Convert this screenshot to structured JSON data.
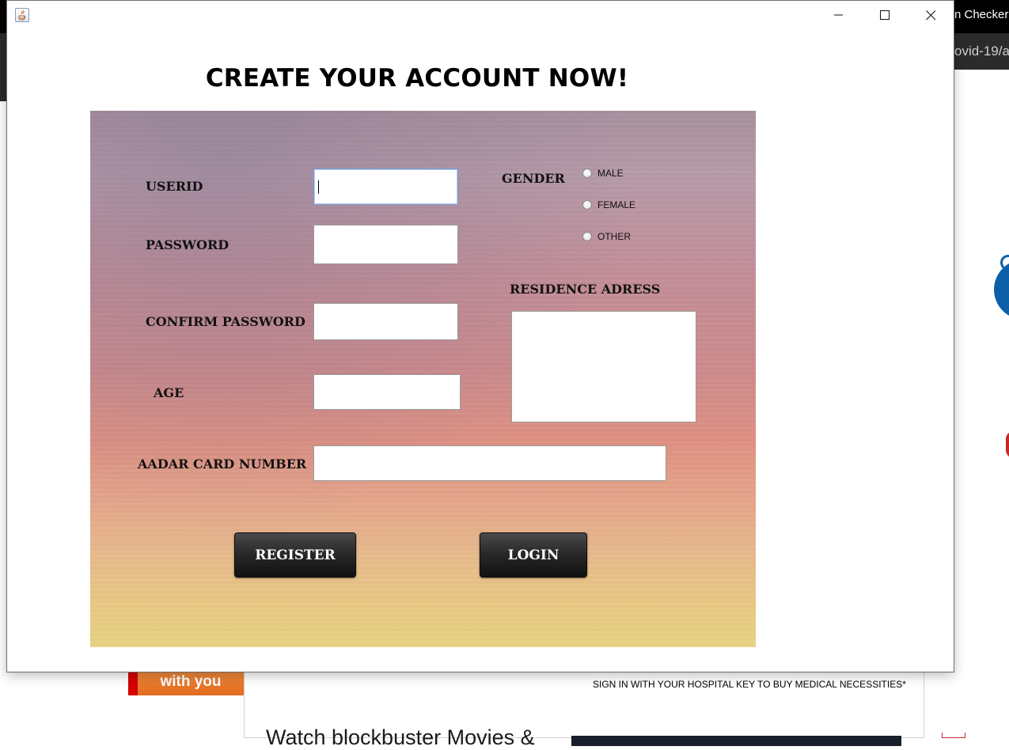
{
  "background": {
    "tab_title_fragment": "n Checker |",
    "url_fragment": "ovid-19/a",
    "ad_text": "with you",
    "signin_notice": "SIGN IN WITH YOUR HOSPITAL KEY TO BUY MEDICAL NECESSITIES*",
    "promo_text": "Watch blockbuster Movies &"
  },
  "window": {
    "heading": "CREATE YOUR ACCOUNT NOW!",
    "controls": {
      "minimize": "minimize",
      "maximize": "maximize",
      "close": "close"
    }
  },
  "form": {
    "userid": {
      "label": "USERID",
      "value": ""
    },
    "password": {
      "label": "PASSWORD",
      "value": ""
    },
    "confirm_password": {
      "label": "CONFIRM PASSWORD",
      "value": ""
    },
    "age": {
      "label": "AGE",
      "value": ""
    },
    "aadar": {
      "label": "AADAR CARD NUMBER",
      "value": ""
    },
    "gender": {
      "label": "GENDER",
      "options": [
        "MALE",
        "FEMALE",
        "OTHER"
      ],
      "selected": null
    },
    "address": {
      "label": "RESIDENCE ADRESS",
      "value": ""
    }
  },
  "actions": {
    "register": "REGISTER",
    "login": "LOGIN"
  },
  "colors": {
    "button_dark": "#1f1f1f",
    "sky_top": "#a8909e",
    "sky_bottom": "#e7d282"
  }
}
